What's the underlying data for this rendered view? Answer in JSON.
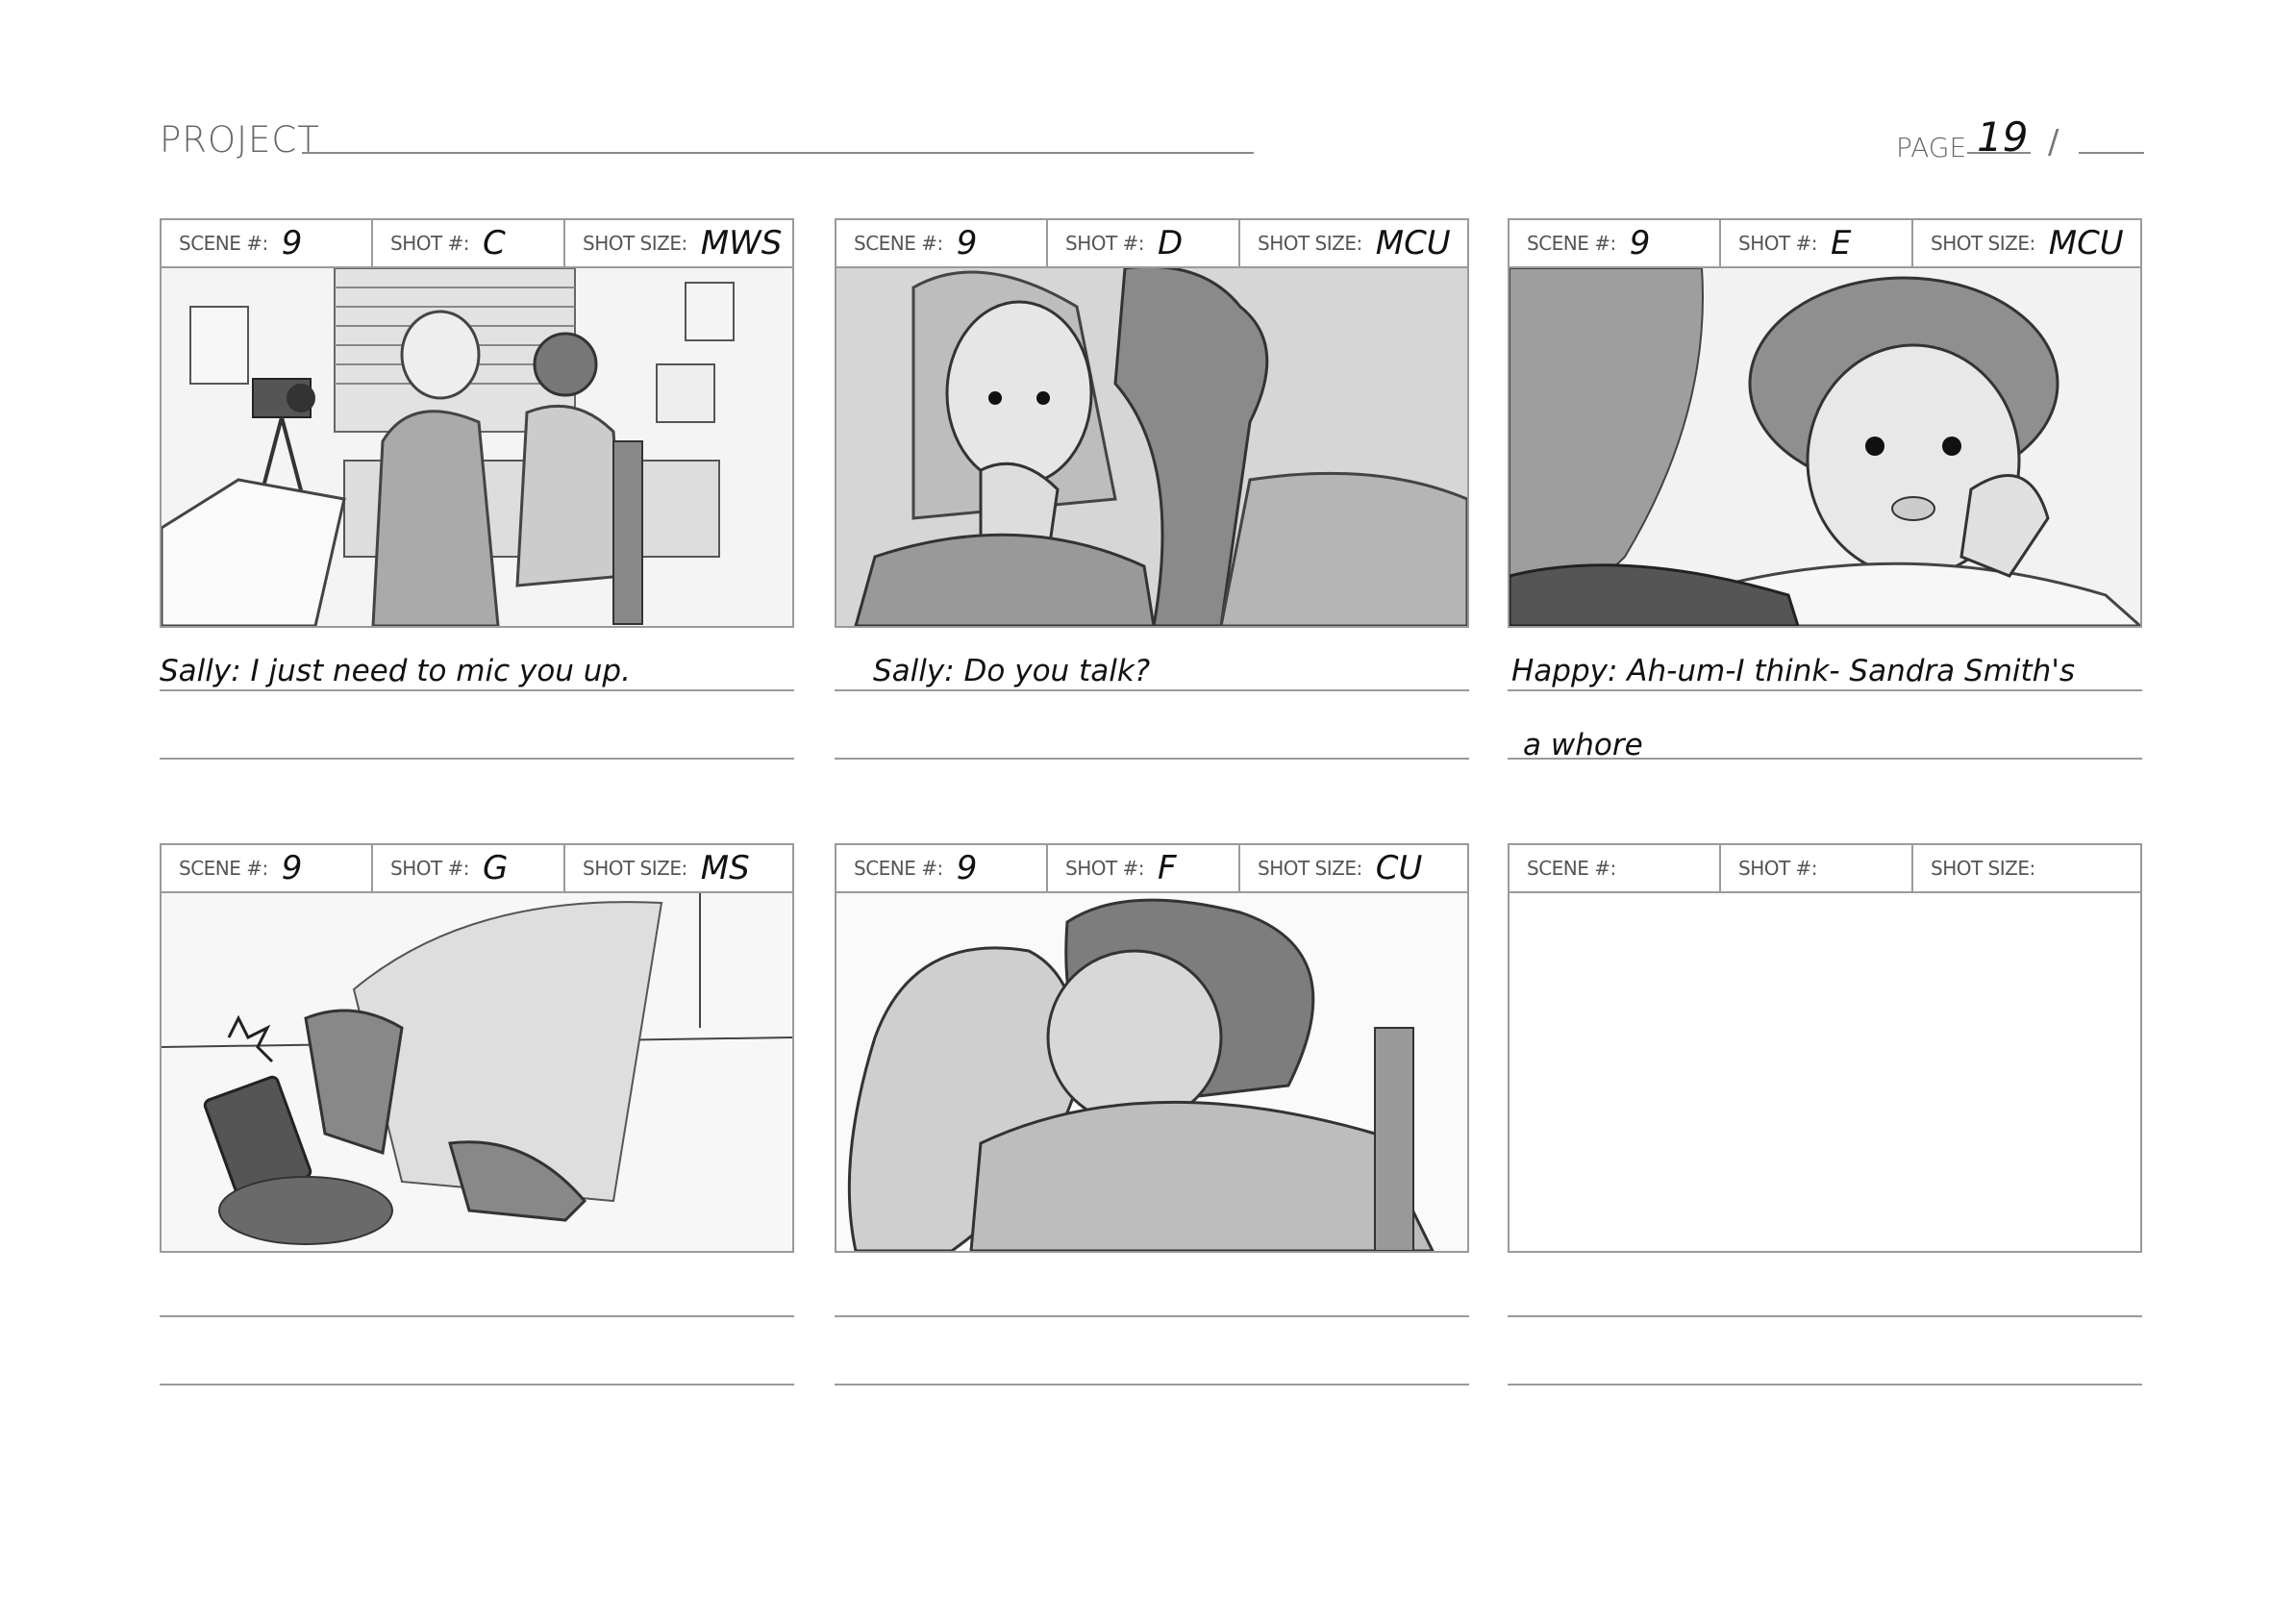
{
  "header": {
    "project_label": "PROJECT",
    "page_label": "PAGE",
    "page_number": "19",
    "page_separator": "/"
  },
  "labels": {
    "scene": "SCENE #:",
    "shot": "SHOT #:",
    "shot_size": "SHOT SIZE:"
  },
  "panels": [
    {
      "scene": "9",
      "shot": "C",
      "shot_size": "MWS",
      "dialogue_1": "Sally: I just need to mic you up.",
      "dialogue_2": ""
    },
    {
      "scene": "9",
      "shot": "D",
      "shot_size": "MCU",
      "dialogue_1": "Sally: Do you talk?",
      "dialogue_2": ""
    },
    {
      "scene": "9",
      "shot": "E",
      "shot_size": "MCU",
      "dialogue_1": "Happy: Ah-um-I think- Sandra Smith's",
      "dialogue_2": "a whore"
    },
    {
      "scene": "9",
      "shot": "G",
      "shot_size": "MS",
      "dialogue_1": "",
      "dialogue_2": ""
    },
    {
      "scene": "9",
      "shot": "F",
      "shot_size": "CU",
      "dialogue_1": "",
      "dialogue_2": ""
    },
    {
      "scene": "",
      "shot": "",
      "shot_size": "",
      "dialogue_1": "",
      "dialogue_2": ""
    }
  ]
}
